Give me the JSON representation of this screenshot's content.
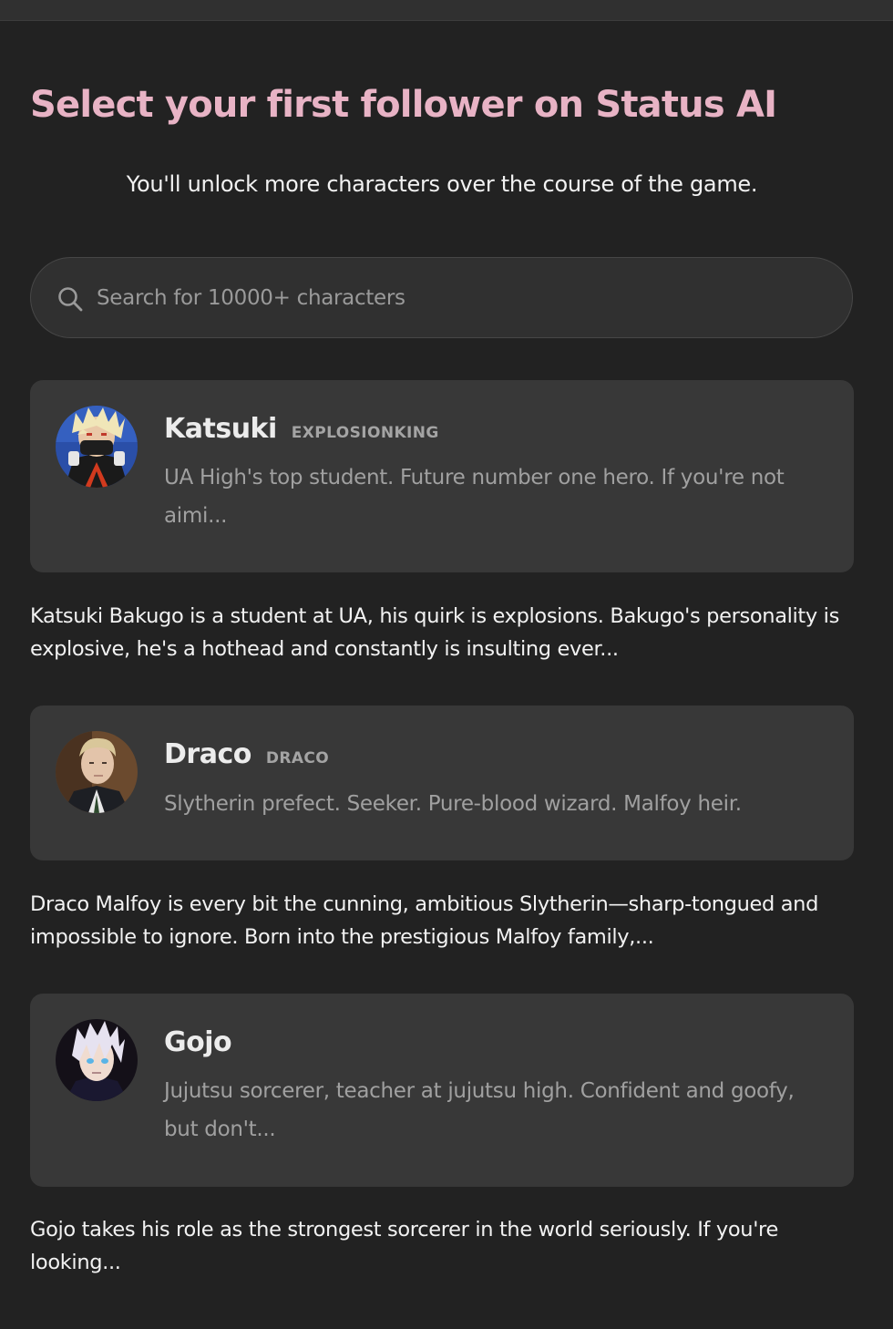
{
  "header": {
    "title": "Select your first follower on Status AI",
    "subtitle": "You'll unlock more characters over the course of the game."
  },
  "search": {
    "placeholder": "Search for 10000+ characters",
    "icon": "search-icon"
  },
  "characters": [
    {
      "name": "Katsuki",
      "handle": "EXPLOSIONKING",
      "tagline": "UA High's top student. Future number one hero. If you're not aimi...",
      "description": "Katsuki Bakugo is a student at UA, his quirk is explosions. Bakugo's personality is explosive, he's a hothead and constantly is insulting ever...",
      "avatar": "katsuki-avatar"
    },
    {
      "name": "Draco",
      "handle": "DRACO",
      "tagline": "Slytherin prefect. Seeker. Pure-blood wizard. Malfoy heir.",
      "description": "Draco Malfoy is every bit the cunning, ambitious Slytherin—sharp-tongued and impossible to ignore. Born into the prestigious Malfoy family,...",
      "avatar": "draco-avatar"
    },
    {
      "name": "Gojo",
      "handle": "",
      "tagline": "Jujutsu sorcerer, teacher at jujutsu high. Confident and goofy, but don't...",
      "description": "Gojo takes his role as the strongest sorcerer in the world seriously. If you're looking...",
      "avatar": "gojo-avatar"
    }
  ],
  "colors": {
    "background": "#222222",
    "card": "#383838",
    "title_accent": "#e8b3c5",
    "muted_text": "#a0a0a0"
  }
}
